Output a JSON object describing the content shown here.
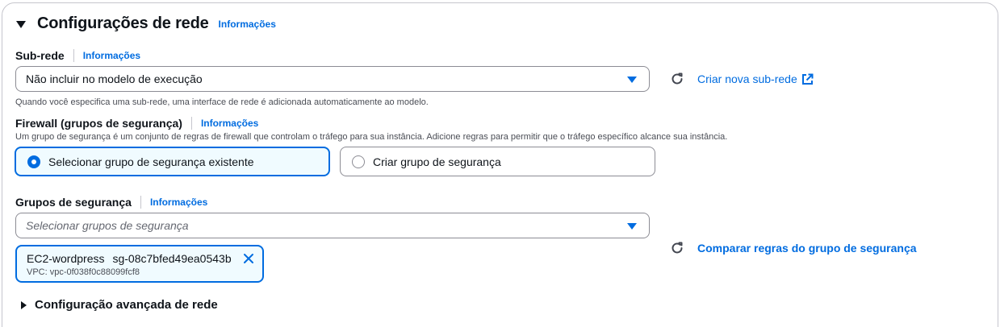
{
  "section": {
    "title": "Configurações de rede",
    "info": "Informações"
  },
  "subnet": {
    "label": "Sub-rede",
    "info": "Informações",
    "value": "Não incluir no modelo de execução",
    "create_link": "Criar nova sub-rede",
    "help": "Quando você especifica uma sub-rede, uma interface de rede é adicionada automaticamente ao modelo."
  },
  "firewall": {
    "label": "Firewall (grupos de segurança)",
    "info": "Informações",
    "help": "Um grupo de segurança é um conjunto de regras de firewall que controlam o tráfego para sua instância. Adicione regras para permitir que o tráfego específico alcance sua instância.",
    "option_existing": "Selecionar grupo de segurança existente",
    "option_create": "Criar grupo de segurança",
    "selected_option": "existing"
  },
  "security_groups": {
    "label": "Grupos de segurança",
    "info": "Informações",
    "placeholder": "Selecionar grupos de segurança",
    "compare_link": "Comparar regras do grupo de segurança",
    "tokens": [
      {
        "name": "EC2-wordpress",
        "id": "sg-08c7bfed49ea0543b",
        "vpc": "VPC: vpc-0f038f0c88099fcf8"
      }
    ]
  },
  "advanced": {
    "label": "Configuração avançada de rede"
  },
  "colors": {
    "link": "#006ce0",
    "text": "#0f141a",
    "border": "#8c8c94",
    "selected_bg": "#f0fbff"
  }
}
